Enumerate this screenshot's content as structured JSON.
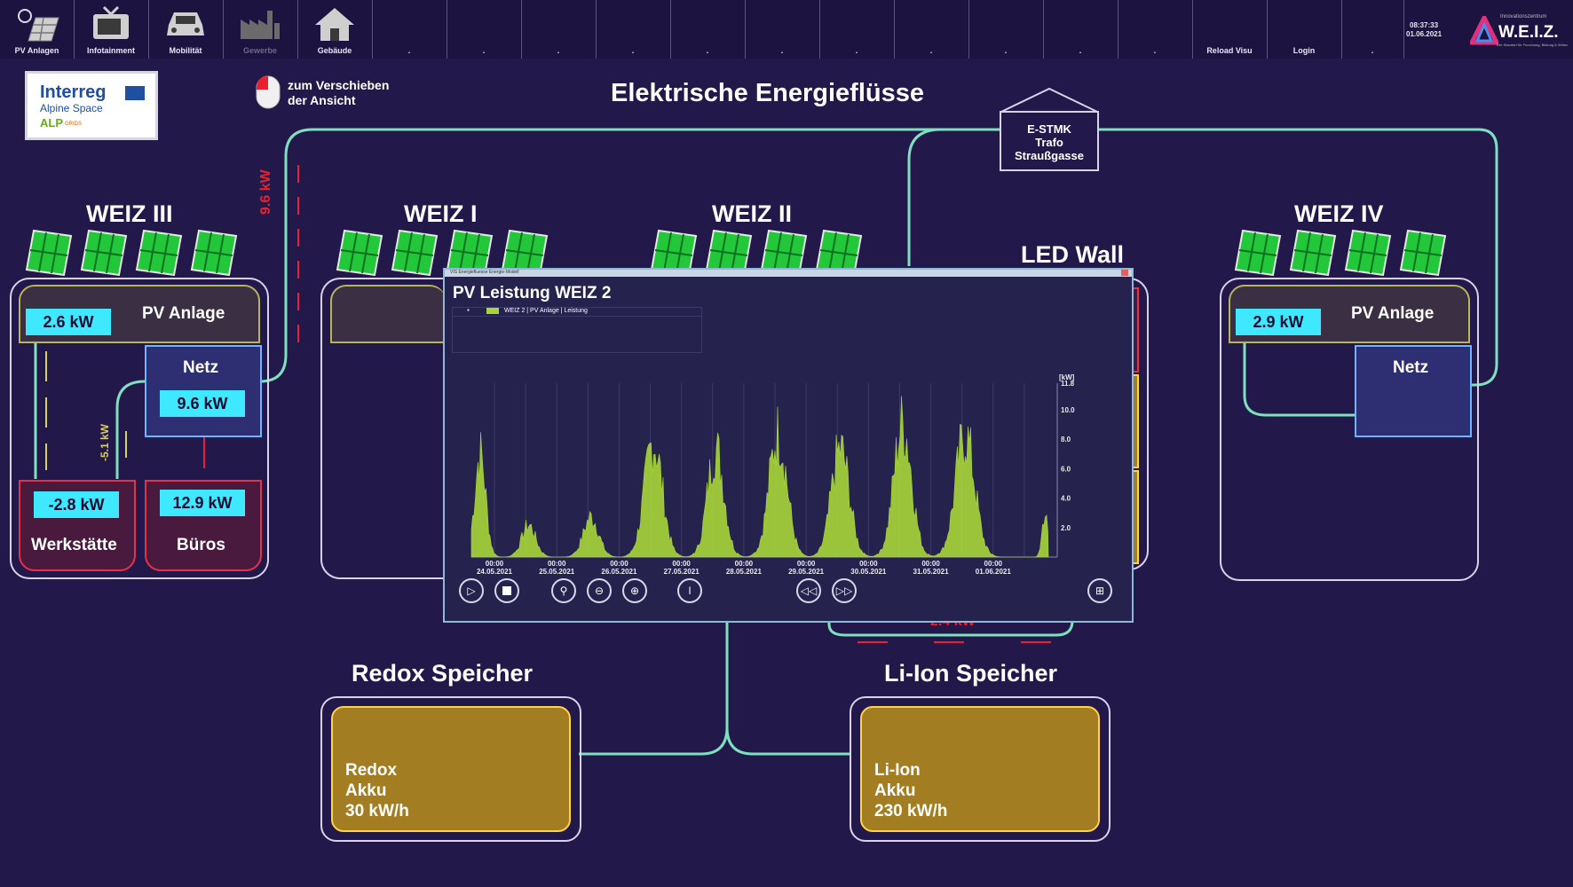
{
  "toolbar": {
    "items": [
      {
        "label": "PV Anlagen",
        "icon": "solar-panel-icon"
      },
      {
        "label": "Infotainment",
        "icon": "tv-icon"
      },
      {
        "label": "Mobilität",
        "icon": "car-icon"
      },
      {
        "label": "Gewerbe",
        "icon": "factory-icon"
      },
      {
        "label": "Gebäude",
        "icon": "house-icon"
      }
    ],
    "empty_items": [
      ".",
      ".",
      ".",
      ".",
      ".",
      ".",
      ".",
      ".",
      ".",
      ".",
      ".",
      ".",
      "."
    ],
    "reload_label": "Reload Visu",
    "login_label": "Login",
    "time": "08:37:33",
    "date": "01.06.2021",
    "brand_small": "Innovationszentrum",
    "brand_name": "W.E.I.Z.",
    "brand_tagline": "Der Standort für Forschung, Bildung & Wirtschaft"
  },
  "logo": {
    "line1": "Interreg",
    "line2": "Alpine Space",
    "line3": "ALP",
    "line4": "GRIDS"
  },
  "mouse_hint": {
    "line1": "zum Verschieben",
    "line2": "der Ansicht"
  },
  "page_title": "Elektrische Energieflüsse",
  "trafo": {
    "line1": "E-STMK",
    "line2": "Trafo",
    "line3": "Straußgasse"
  },
  "flows": {
    "weiz3_grid": "9.6 kW",
    "weiz3_werk": "-5.1 kW",
    "li_ion": "2.4 kW"
  },
  "sites": {
    "weiz3": {
      "title": "WEIZ III",
      "pv_label": "PV Anlage",
      "pv_value": "2.6 kW",
      "netz_label": "Netz",
      "netz_value": "9.6 kW",
      "werk_value": "-2.8 kW",
      "werk_label": "Werkstätte",
      "bueros_value": "12.9 kW",
      "bueros_label": "Büros"
    },
    "weiz1": {
      "title": "WEIZ I"
    },
    "weiz2": {
      "title": "WEIZ II"
    },
    "led": {
      "title": "LED Wall"
    },
    "weiz4": {
      "title": "WEIZ IV",
      "pv_label": "PV Anlage",
      "pv_value": "2.9 kW",
      "netz_label": "Netz"
    }
  },
  "storage": {
    "redox": {
      "title": "Redox Speicher",
      "line1": "Redox",
      "line2": "Akku",
      "line3": "30 kW/h"
    },
    "liion": {
      "title": "Li-Ion Speicher",
      "line1": "Li-Ion",
      "line2": "Akku",
      "line3": "230 kW/h"
    }
  },
  "popup": {
    "window_caption": "VIS Energiefluesse Energie-Modell",
    "title": "PV Leistung WEIZ 2",
    "legend_marker": "▪",
    "legend_label": "WEIZ 2 | PV Anlage | Leistung",
    "series_color": "#a8d63a",
    "controls": [
      "play-icon",
      "stop-icon",
      "zoom-fit-icon",
      "zoom-out-icon",
      "zoom-in-icon",
      "cursor-icon",
      "rewind-icon",
      "forward-icon",
      "export-icon"
    ]
  },
  "chart_data": {
    "type": "area",
    "title": "PV Leistung WEIZ 2",
    "ylabel": "[kW]",
    "ylim": [
      0,
      11.8
    ],
    "yticks": [
      "2.0",
      "4.0",
      "6.0",
      "8.0",
      "10.0",
      "11.8"
    ],
    "xticks": [
      {
        "time": "00:00",
        "date": "24.05.2021"
      },
      {
        "time": "00:00",
        "date": "25.05.2021"
      },
      {
        "time": "00:00",
        "date": "26.05.2021"
      },
      {
        "time": "00:00",
        "date": "27.05.2021"
      },
      {
        "time": "00:00",
        "date": "28.05.2021"
      },
      {
        "time": "00:00",
        "date": "29.05.2021"
      },
      {
        "time": "00:00",
        "date": "30.05.2021"
      },
      {
        "time": "00:00",
        "date": "31.05.2021"
      },
      {
        "time": "00:00",
        "date": "01.06.2021"
      }
    ],
    "series": [
      {
        "name": "WEIZ 2 | PV Anlage | Leistung",
        "daily_peak_kw": [
          9.0,
          2.8,
          3.5,
          10.0,
          9.4,
          10.8,
          9.4,
          11.6,
          10.6,
          3.8
        ],
        "daily_spread": [
          0.8,
          1.0,
          1.1,
          1.3,
          1.2,
          1.3,
          1.3,
          1.3,
          1.4,
          0.4
        ]
      }
    ],
    "grid": true
  }
}
